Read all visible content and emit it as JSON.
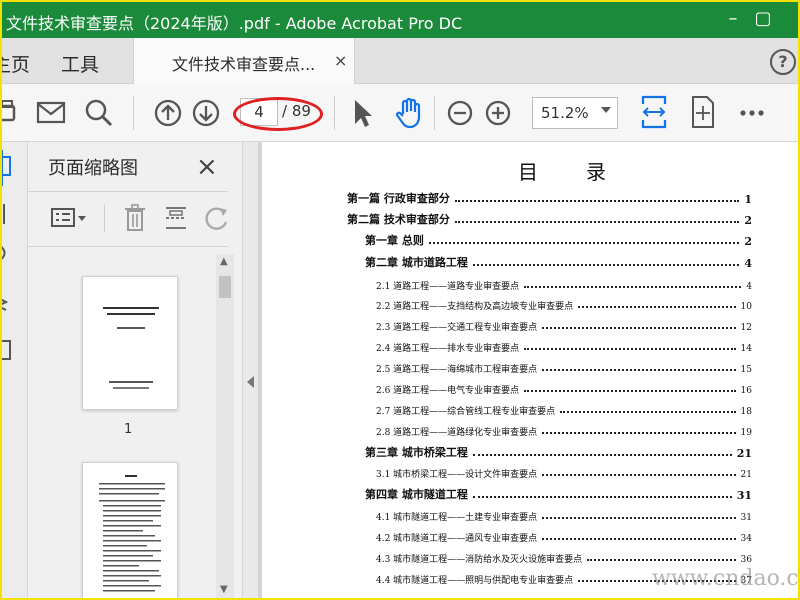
{
  "window": {
    "title": "文件技术审查要点（2024年版）.pdf - Adobe Acrobat Pro DC",
    "title_color": "#1c8a3b"
  },
  "menu": {
    "home_label": "主页",
    "tools_label": "工具",
    "tab_label": "文件技术审查要点...",
    "tab_close": "×",
    "help_label": "?"
  },
  "toolbar": {
    "current_page": "4",
    "total_pages": "/ 89",
    "zoom_value": "51.2%",
    "icons": [
      "print-icon",
      "mail-icon",
      "search-icon",
      "page-up-icon",
      "page-down-icon",
      "select-cursor-icon",
      "hand-tool-icon",
      "zoom-out-icon",
      "zoom-in-icon",
      "fit-width-icon",
      "scroll-mode-icon",
      "more-icon"
    ]
  },
  "thumbnail_panel": {
    "title": "页面缩略图",
    "close": "×",
    "thumbnails": [
      {
        "label": "1"
      }
    ]
  },
  "document": {
    "toc_heading": "目　录",
    "entries": [
      {
        "level": 1,
        "text": "第一篇  行政审查部分",
        "page": "1"
      },
      {
        "level": 1,
        "text": "第二篇  技术审查部分",
        "page": "2"
      },
      {
        "level": 1,
        "text": "第一章    总则",
        "page": "2"
      },
      {
        "level": 1,
        "text": "第二章    城市道路工程",
        "page": "4"
      },
      {
        "level": 2,
        "text": "2.1 道路工程——道路专业审查要点",
        "page": "4"
      },
      {
        "level": 2,
        "text": "2.2 道路工程——支挡结构及高边坡专业审查要点",
        "page": "10"
      },
      {
        "level": 2,
        "text": "2.3 道路工程——交通工程专业审查要点",
        "page": "12"
      },
      {
        "level": 2,
        "text": "2.4 道路工程——排水专业审查要点",
        "page": "14"
      },
      {
        "level": 2,
        "text": "2.5 道路工程——海绵城市工程审查要点",
        "page": "15"
      },
      {
        "level": 2,
        "text": "2.6 道路工程——电气专业审查要点",
        "page": "16"
      },
      {
        "level": 2,
        "text": "2.7 道路工程——综合管线工程专业审查要点",
        "page": "18"
      },
      {
        "level": 2,
        "text": "2.8 道路工程——道路绿化专业审查要点",
        "page": "19"
      },
      {
        "level": 1,
        "text": "第三章    城市桥梁工程",
        "page": "21"
      },
      {
        "level": 2,
        "text": "3.1 城市桥梁工程——设计文件审查要点",
        "page": "21"
      },
      {
        "level": 1,
        "text": "第四章  城市隧道工程",
        "page": "31"
      },
      {
        "level": 2,
        "text": "4.1 城市隧道工程——土建专业审查要点",
        "page": "31"
      },
      {
        "level": 2,
        "text": "4.2 城市隧道工程——通风专业审查要点",
        "page": "34"
      },
      {
        "level": 2,
        "text": "4.3 城市隧道工程——消防给水及灭火设施审查要点",
        "page": "36"
      },
      {
        "level": 2,
        "text": "4.4 城市隧道工程——照明与供配电专业审查要点",
        "page": "37"
      }
    ]
  },
  "watermark": "www.cndao.com"
}
